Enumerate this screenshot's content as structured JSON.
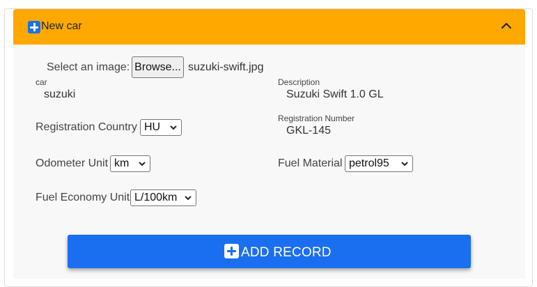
{
  "panel": {
    "title": "New car",
    "colors": {
      "header": "#ffa800",
      "accent": "#1a6ef0"
    }
  },
  "form": {
    "image": {
      "label": "Select an image:",
      "button": "Browse...",
      "filename": "suzuki-swift.jpg"
    },
    "car": {
      "label": "car",
      "value": "suzuki"
    },
    "description": {
      "label": "Description",
      "value": "Suzuki Swift 1.0 GL"
    },
    "registration_country": {
      "label": "Registration Country",
      "value": "HU"
    },
    "registration_number": {
      "label": "Registration Number",
      "value": "GKL-145"
    },
    "odometer_unit": {
      "label": "Odometer Unit",
      "value": "km"
    },
    "fuel_material": {
      "label": "Fuel Material",
      "value": "petrol95"
    },
    "fuel_economy_unit": {
      "label": "Fuel Economy Unit",
      "value": "L/100km"
    }
  },
  "actions": {
    "add_record": "ADD RECORD"
  },
  "icons": {
    "header": "plus-square-icon",
    "collapse": "chevron-up-icon",
    "button": "plus-square-icon"
  }
}
